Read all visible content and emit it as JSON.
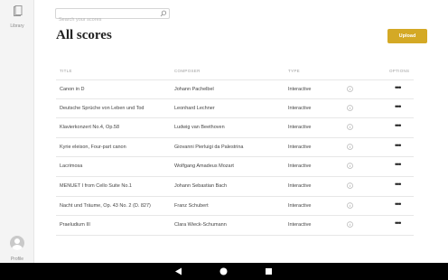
{
  "sidebar": {
    "library_label": "Library",
    "profile_label": "Profile"
  },
  "search": {
    "placeholder": "Search your scores"
  },
  "page_title": "All scores",
  "upload_label": "Upload",
  "columns": {
    "title": "TITLE",
    "composer": "COMPOSER",
    "type": "TYPE",
    "options": "OPTIONS"
  },
  "rows": [
    {
      "title": "Canon in D",
      "composer": "Johann Pachelbel",
      "type": "Interactive",
      "menu": "•••"
    },
    {
      "title": "Deutsche Sprüche von Leben und Tod",
      "composer": "Leonhard Lechner",
      "type": "Interactive",
      "menu": "•••"
    },
    {
      "title": "Klavierkonzert No.4, Op.58",
      "composer": "Ludwig van Beethoven",
      "type": "Interactive",
      "menu": "•••"
    },
    {
      "title": "Kyrie eleison, Four-part canon",
      "composer": "Giovanni Pierluigi da Palestrina",
      "type": "Interactive",
      "menu": "•••"
    },
    {
      "title": "Lacrimosa",
      "composer": "Wolfgang Amadeus Mozart",
      "type": "Interactive",
      "menu": "•••"
    },
    {
      "title": "MENUET I from Cello Suite No.1",
      "composer": "Johann Sebastian Bach",
      "type": "Interactive",
      "menu": "•••"
    },
    {
      "title": "Nacht und Träume, Op. 43 No. 2 (D. 827)",
      "composer": "Franz Schubert",
      "type": "Interactive",
      "menu": "•••"
    },
    {
      "title": "Praeludium III",
      "composer": "Clara Wieck-Schumann",
      "type": "Interactive",
      "menu": "•••"
    }
  ],
  "colors": {
    "accent": "#d4a925",
    "sidebar_bg": "#f4f4f4",
    "navbar_bg": "#000000"
  },
  "icons": {
    "library": "library-icon",
    "search": "search-icon",
    "info": "info-icon",
    "profile": "avatar",
    "back": "back-icon",
    "home": "home-icon",
    "recent": "recent-apps-icon"
  }
}
